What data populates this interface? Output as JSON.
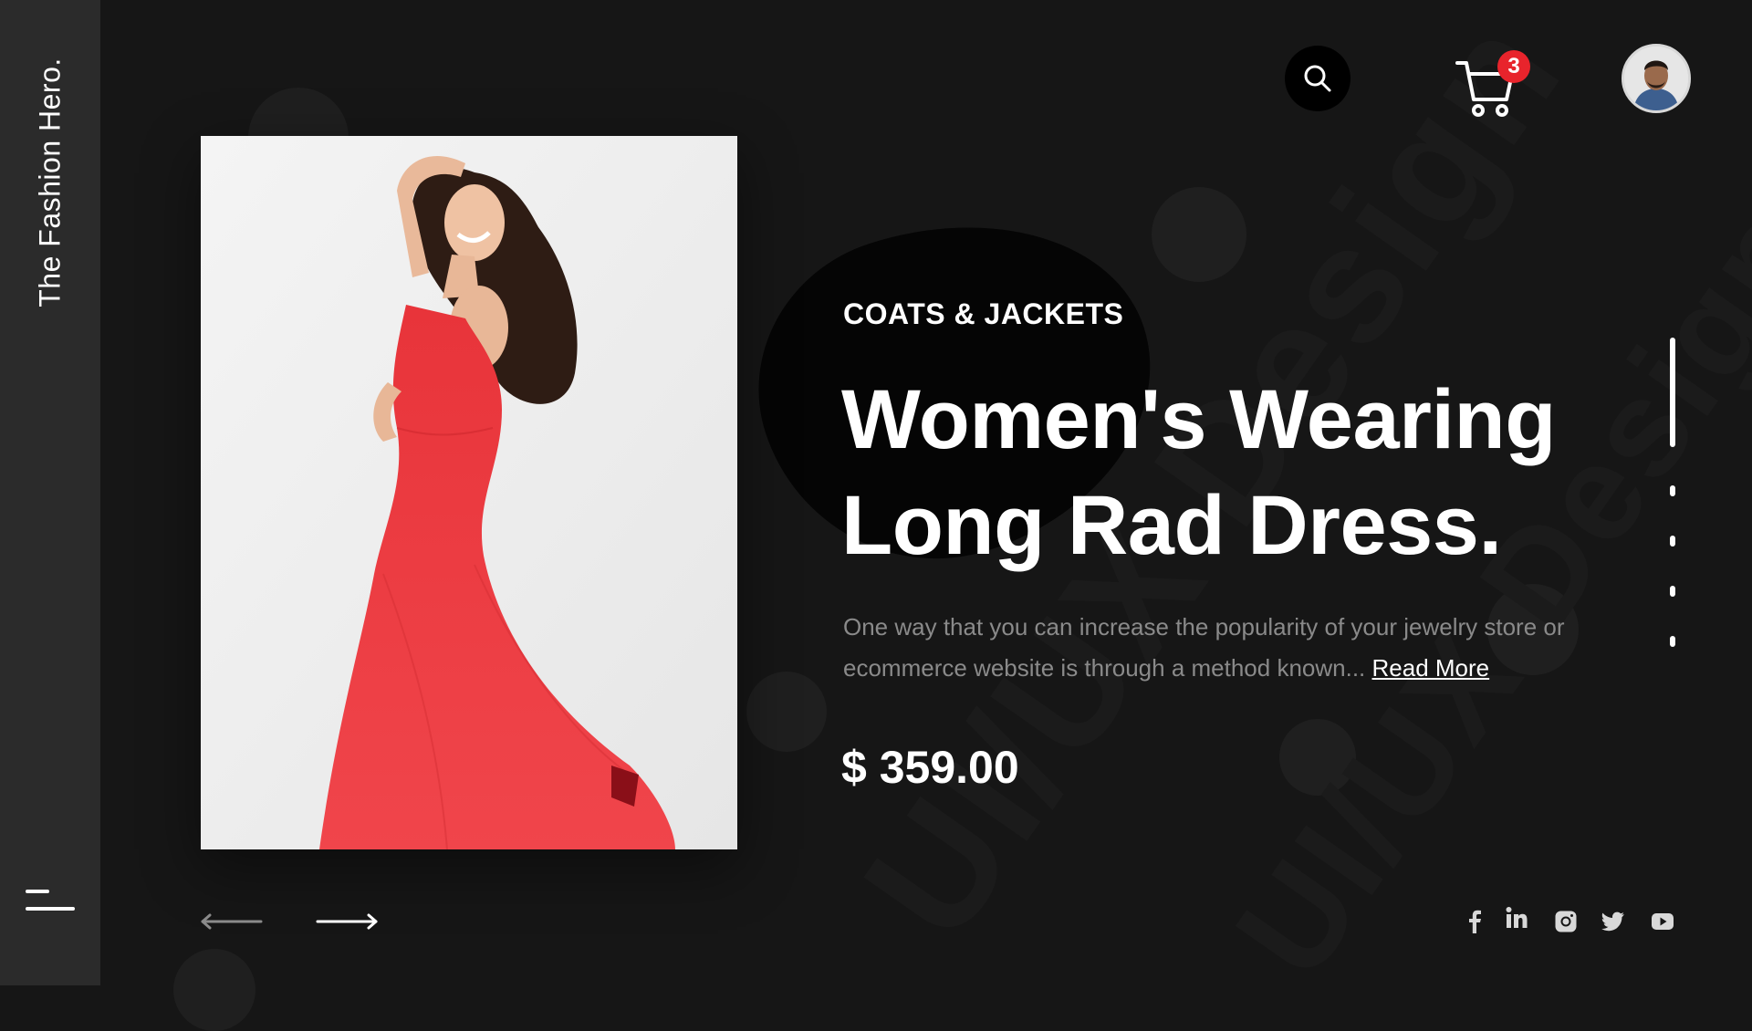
{
  "brand": {
    "name": "The Fashion Hero."
  },
  "header": {
    "cart_count": "3"
  },
  "product": {
    "category": "COATS & JACKETS",
    "title_line1": "Women's Wearing",
    "title_line2": "Long Rad Dress.",
    "description": "One way that you can increase the popularity of your jewelry store or ecommerce website is through a method known...",
    "read_more": "Read More",
    "price": "$ 359.00"
  },
  "slider": {
    "total_slides": 5,
    "active_index": 1
  },
  "social": [
    "facebook-icon",
    "linkedin-icon",
    "instagram-icon",
    "twitter-icon",
    "youtube-icon"
  ],
  "colors": {
    "background": "#161616",
    "sidebar": "#2b2b2b",
    "accent_badge": "#e8242c",
    "dress": "#e8343a",
    "text_muted": "#8a8a8a"
  }
}
